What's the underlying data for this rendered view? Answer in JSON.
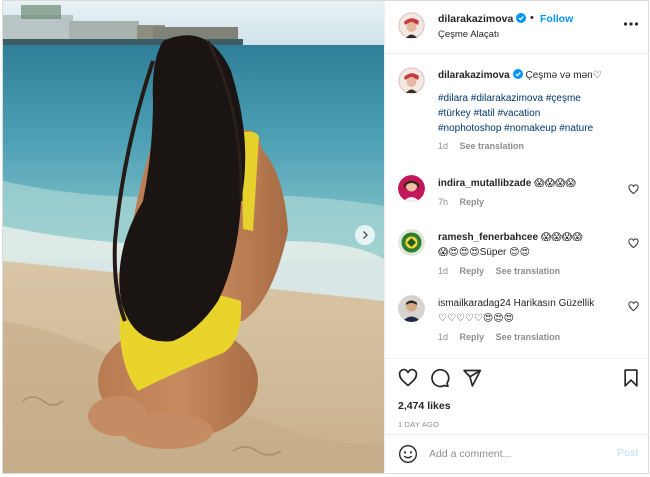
{
  "colors": {
    "link": "#0095f6",
    "hashtag": "#00376b",
    "muted": "#8e8e8e",
    "text": "#262626"
  },
  "photo": {
    "subject": "photo"
  },
  "header": {
    "username": "dilarakazimova",
    "separator": "•",
    "follow_label": "Follow",
    "location": "Çeşme Alaçatı"
  },
  "caption": {
    "username": "dilarakazimova",
    "text": "Çeşmə və mən♡",
    "hashtags_line1": "#dilara #dilarakazimova #çeşme",
    "hashtags_line2": "#türkey #tatil #vacation",
    "hashtags_line3": "#nophotoshop #nomakeup #nature",
    "time": "1d",
    "see_translation": "See translation"
  },
  "comments": [
    {
      "username": "indira_mutallibzade",
      "text": "😱😱😱😱",
      "time": "7h",
      "reply": "Reply",
      "see_translation": ""
    },
    {
      "username": "ramesh_fenerbahcee",
      "text": "😱😱😱😱",
      "text2": "😱😍😍😍Süper 😊😍",
      "time": "1d",
      "reply": "Reply",
      "see_translation": "See translation"
    },
    {
      "username": "ismailkaradag24",
      "text": "Harikasın Güzellik",
      "text2": "♡♡♡♡♡😍😍😍",
      "time": "1d",
      "reply": "Reply",
      "see_translation": "See translation"
    }
  ],
  "actions": {
    "likes": "2,474 likes",
    "ago": "1 DAY AGO",
    "icons": [
      "heart-icon",
      "comment-icon",
      "share-icon",
      "bookmark-icon"
    ]
  },
  "composer": {
    "placeholder": "Add a comment...",
    "value": "",
    "post_label": "Post"
  }
}
